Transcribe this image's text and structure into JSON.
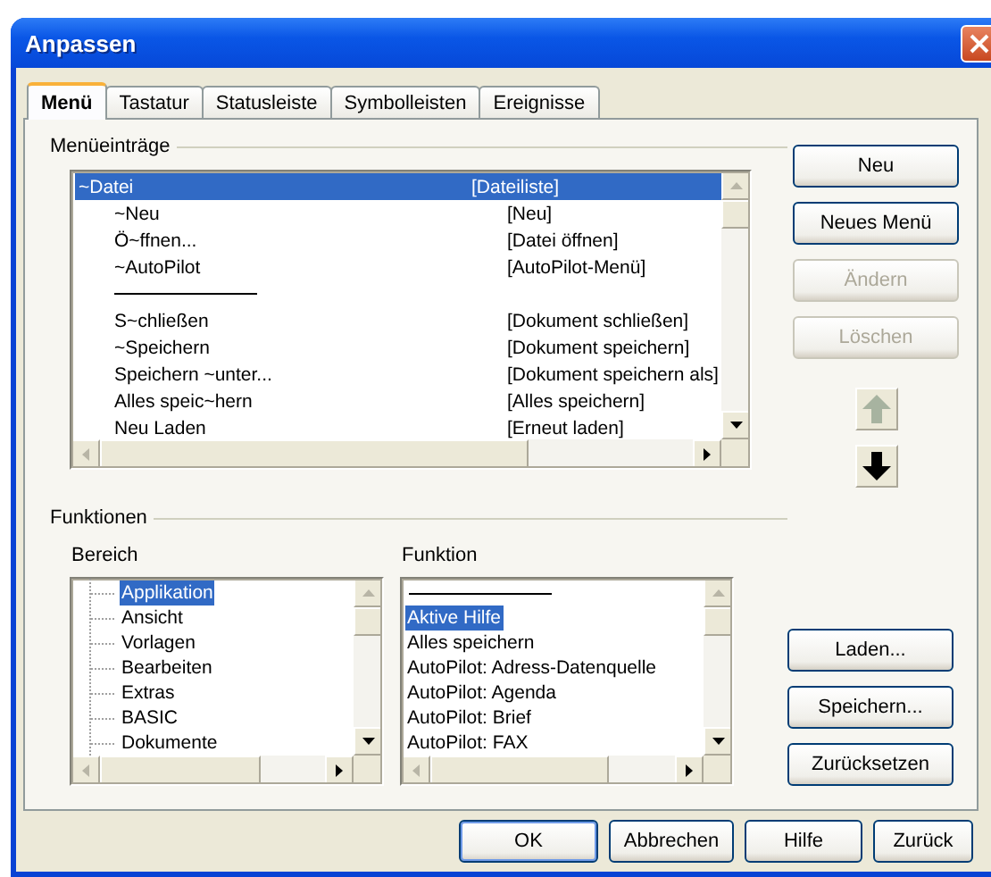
{
  "window": {
    "title": "Anpassen"
  },
  "tabs": [
    {
      "label": "Menü",
      "selected": true
    },
    {
      "label": "Tastatur",
      "selected": false
    },
    {
      "label": "Statusleiste",
      "selected": false
    },
    {
      "label": "Symbolleisten",
      "selected": false
    },
    {
      "label": "Ereignisse",
      "selected": false
    }
  ],
  "menu_entries": {
    "label": "Menüeinträge",
    "rows": [
      {
        "kind": "item",
        "name": "~Datei",
        "command": "[Dateiliste]",
        "selected": true,
        "children": [
          {
            "kind": "item",
            "name": "~Neu",
            "command": "[Neu]",
            "selected": false
          },
          {
            "kind": "item",
            "name": "Ö~ffnen...",
            "command": "[Datei öffnen]",
            "selected": false
          },
          {
            "kind": "item",
            "name": "~AutoPilot",
            "command": "[AutoPilot-Menü]",
            "selected": false
          },
          {
            "kind": "separator"
          },
          {
            "kind": "item",
            "name": "S~chließen",
            "command": "[Dokument schließen]",
            "selected": false
          },
          {
            "kind": "item",
            "name": "~Speichern",
            "command": "[Dokument speichern]",
            "selected": false
          },
          {
            "kind": "item",
            "name": "Speichern ~unter...",
            "command": "[Dokument speichern als]",
            "selected": false
          },
          {
            "kind": "item",
            "name": "Alles speic~hern",
            "command": "[Alles speichern]",
            "selected": false
          },
          {
            "kind": "item",
            "name": "Neu Laden",
            "command": "[Erneut laden]",
            "selected": false
          }
        ]
      }
    ]
  },
  "menu_buttons": [
    {
      "label": "Neu",
      "disabled": false
    },
    {
      "label": "Neues Menü",
      "disabled": false
    },
    {
      "label": "Ändern",
      "disabled": true
    },
    {
      "label": "Löschen",
      "disabled": true
    }
  ],
  "move_buttons": [
    {
      "kind": "up",
      "disabled": true
    },
    {
      "kind": "down",
      "disabled": false
    }
  ],
  "functions": {
    "label": "Funktionen",
    "area": {
      "label": "Bereich",
      "items": [
        {
          "text": "Applikation",
          "selected": true
        },
        {
          "text": "Ansicht",
          "selected": false
        },
        {
          "text": "Vorlagen",
          "selected": false
        },
        {
          "text": "Bearbeiten",
          "selected": false
        },
        {
          "text": "Extras",
          "selected": false
        },
        {
          "text": "BASIC",
          "selected": false
        },
        {
          "text": "Dokumente",
          "selected": false
        }
      ]
    },
    "function": {
      "label": "Funktion",
      "items": [
        {
          "kind": "separator"
        },
        {
          "kind": "item",
          "text": "Aktive Hilfe",
          "selected": true
        },
        {
          "kind": "item",
          "text": "Alles speichern",
          "selected": false
        },
        {
          "kind": "item",
          "text": "AutoPilot: Adress-Datenquelle",
          "selected": false
        },
        {
          "kind": "item",
          "text": "AutoPilot: Agenda",
          "selected": false
        },
        {
          "kind": "item",
          "text": "AutoPilot: Brief",
          "selected": false
        },
        {
          "kind": "item",
          "text": "AutoPilot: FAX",
          "selected": false
        }
      ]
    }
  },
  "file_buttons": [
    {
      "label": "Laden..."
    },
    {
      "label": "Speichern..."
    },
    {
      "label": "Zurücksetzen"
    }
  ],
  "dialog_buttons": [
    {
      "label": "OK",
      "default": true
    },
    {
      "label": "Abbrechen",
      "default": false
    },
    {
      "label": "Hilfe",
      "default": false
    },
    {
      "label": "Zurück",
      "default": false
    }
  ]
}
